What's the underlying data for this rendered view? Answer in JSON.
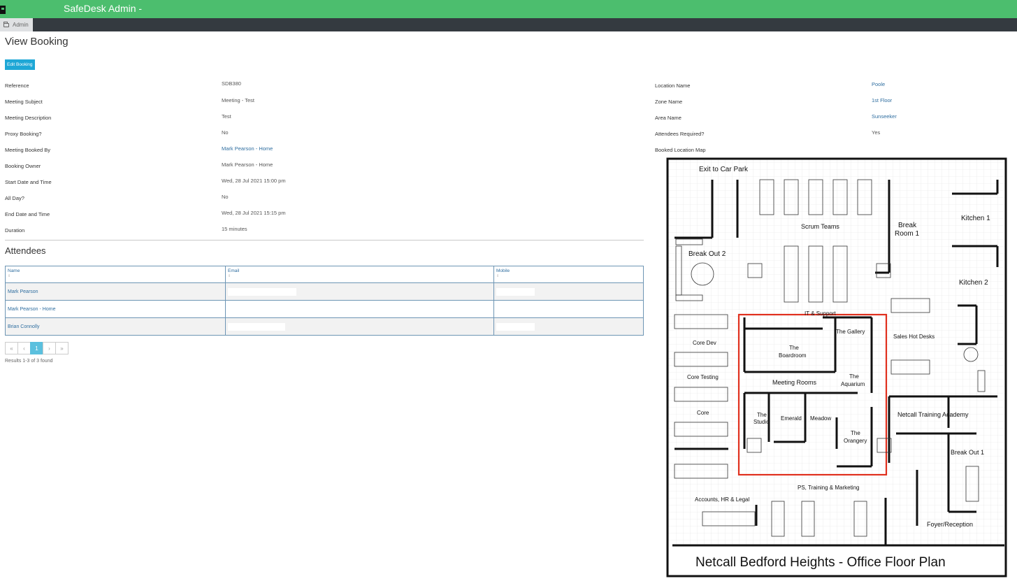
{
  "app": {
    "title": "SafeDesk Admin -"
  },
  "nav": {
    "tab_label": "Admin"
  },
  "page": {
    "title": "View Booking",
    "edit_button": "Edit Booking"
  },
  "details_left": [
    {
      "label": "Reference",
      "value": "SDB380",
      "link": false
    },
    {
      "label": "Meeting Subject",
      "value": "Meeting - Test",
      "link": false
    },
    {
      "label": "Meeting Description",
      "value": "Test",
      "link": false
    },
    {
      "label": "Proxy Booking?",
      "value": "No",
      "link": false
    },
    {
      "label": "Meeting Booked By",
      "value": "Mark Pearson - Home",
      "link": true
    },
    {
      "label": "Booking Owner",
      "value": "Mark Pearson - Home",
      "link": false
    },
    {
      "label": "Start Date and Time",
      "value": "Wed, 28 Jul 2021 15:00 pm",
      "link": false
    },
    {
      "label": "All Day?",
      "value": "No",
      "link": false
    },
    {
      "label": "End Date and Time",
      "value": "Wed, 28 Jul 2021 15:15 pm",
      "link": false
    },
    {
      "label": "Duration",
      "value": "15 minutes",
      "link": false
    }
  ],
  "details_right": [
    {
      "label": "Location Name",
      "value": "Poole",
      "link": true
    },
    {
      "label": "Zone Name",
      "value": "1st Floor",
      "link": true
    },
    {
      "label": "Area Name",
      "value": "Sunseeker",
      "link": true
    },
    {
      "label": "Attendees Required?",
      "value": "Yes",
      "link": false
    }
  ],
  "map_label": "Booked Location Map",
  "attendees": {
    "title": "Attendees",
    "columns": [
      "Name",
      "Email",
      "Mobile"
    ],
    "rows": [
      {
        "name": "Mark Pearson"
      },
      {
        "name": "Mark Pearson - Home"
      },
      {
        "name": "Brian Connolly"
      }
    ]
  },
  "pagination": {
    "first": "«",
    "prev": "‹",
    "current": "1",
    "next": "›",
    "last": "»"
  },
  "results_text": "Results 1-3 of 3 found",
  "floorplan": {
    "title": "Netcall Bedford Heights - Office Floor Plan",
    "labels": {
      "exit": "Exit to Car Park",
      "scrum": "Scrum Teams",
      "break_room": [
        "Break",
        "Room 1"
      ],
      "kitchen1": "Kitchen 1",
      "kitchen2": "Kitchen 2",
      "break_out2": "Break Out 2",
      "it_support": "IT & Support",
      "gallery": "The Gallery",
      "boardroom": [
        "The",
        "Boardroom"
      ],
      "aquarium": [
        "The",
        "Aquarium"
      ],
      "meeting_rooms": "Meeting Rooms",
      "studio": [
        "The",
        "Studio"
      ],
      "emerald": "Emerald",
      "meadow": "Meadow",
      "orangery": [
        "The",
        "Orangery"
      ],
      "sales": "Sales Hot Desks",
      "core_dev": "Core Dev",
      "core_testing": "Core Testing",
      "core": "Core",
      "training": "Netcall Training Academy",
      "break_out1": "Break Out 1",
      "ps": "PS, Training & Marketing",
      "accounts": "Accounts, HR & Legal",
      "foyer": "Foyer/Reception"
    },
    "highlight_color": "#e0301e"
  }
}
